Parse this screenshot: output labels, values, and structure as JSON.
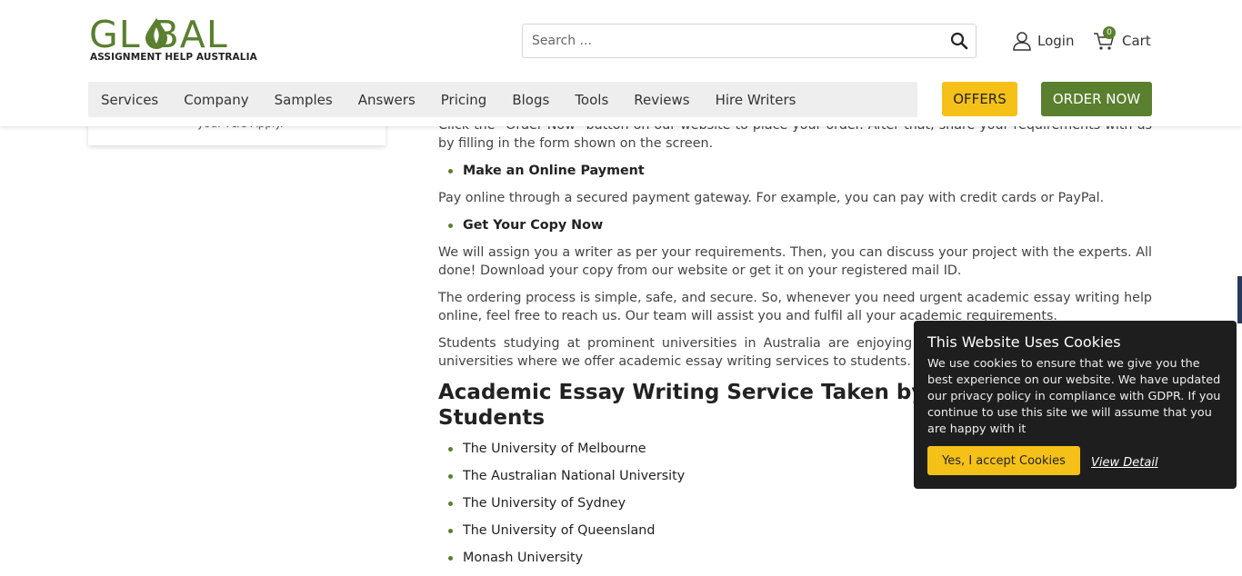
{
  "header": {
    "logo_word": "GL   BAL",
    "logo_sub": "ASSIGNMENT HELP AUSTRALIA",
    "search_placeholder": "Search ...",
    "login_label": "Login",
    "cart_label": "Cart",
    "cart_count": "0"
  },
  "nav": {
    "items": [
      "Services",
      "Company",
      "Samples",
      "Answers",
      "Pricing",
      "Blogs",
      "Tools",
      "Reviews",
      "Hire Writers"
    ],
    "offers_label": "OFFERS",
    "order_label": "ORDER NOW"
  },
  "sidebar": {
    "card_text": "you. T&C Apply."
  },
  "content": {
    "p1": "Click the \"Order Now\" button on our website to place your order. After that, share your requirements with us by filling in the form shown on the screen.",
    "step2": "Make an Online Payment",
    "p2": "Pay online through a secured payment gateway. For example, you can pay with credit cards or PayPal.",
    "step3": "Get Your Copy Now",
    "p3": "We will assign you a writer as per your requirements. Then, you can discuss your project with the experts. All done! Download your copy from our website or get it on your registered mail ID.",
    "p4": "The ordering process is simple, safe, and secure. So, whenever you need urgent academic essay writing help online, feel free to reach us. Our team will assist you and fulfil all your academic requirements.",
    "p5": "Students studying at prominent universities in Australia are enjoying our services. Here is a list of the universities where we offer academic essay writing services to students.",
    "heading": "Academic Essay Writing Service Taken by These University Students",
    "universities": [
      "The University of Melbourne",
      "The Australian National University",
      "The University of Sydney",
      "The University of Queensland",
      "Monash University"
    ]
  },
  "cookie": {
    "title": "This Website Uses Cookies",
    "text": "We use cookies to ensure that we give you the best experience on our website. We have updated our privacy policy in compliance with GDPR. If you continue to use this site we will assume that you are happy with it",
    "accept_label": "Yes, I accept Cookies",
    "view_label": "View Detail"
  },
  "colors": {
    "brand_green": "#5a7f2e",
    "offers_yellow": "#f5c118",
    "cookie_bg": "#1e1e1e"
  }
}
